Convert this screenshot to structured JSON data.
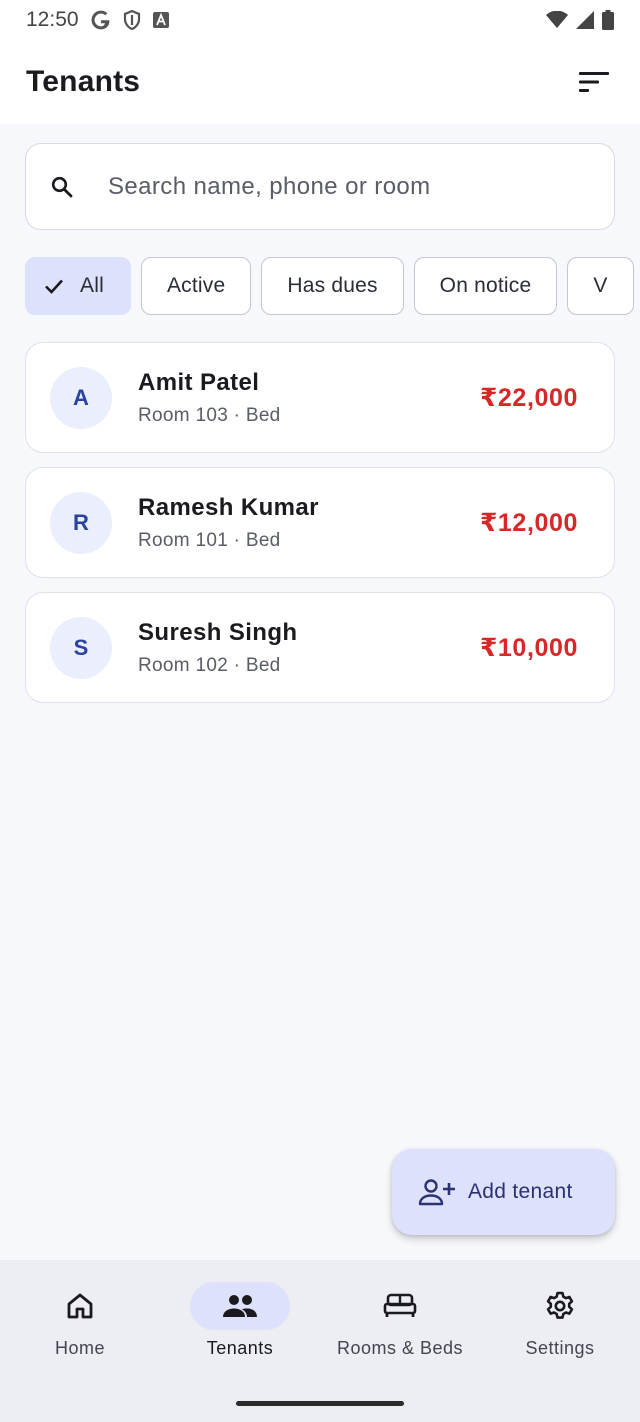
{
  "status_bar": {
    "time": "12:50",
    "icons": [
      "google-icon",
      "shield-icon",
      "font-icon",
      "wifi-icon",
      "signal-icon",
      "battery-icon"
    ]
  },
  "app_bar": {
    "title": "Tenants",
    "sort_icon": "sort-icon"
  },
  "search": {
    "placeholder": "Search name, phone or room",
    "value": ""
  },
  "filters": [
    {
      "label": "All",
      "selected": true
    },
    {
      "label": "Active",
      "selected": false
    },
    {
      "label": "Has dues",
      "selected": false
    },
    {
      "label": "On notice",
      "selected": false
    },
    {
      "label": "V",
      "selected": false
    }
  ],
  "tenants": [
    {
      "initial": "A",
      "name": "Amit Patel",
      "room": "Room 103 · Bed",
      "amount": "₹22,000"
    },
    {
      "initial": "R",
      "name": "Ramesh Kumar",
      "room": "Room 101 · Bed",
      "amount": "₹12,000"
    },
    {
      "initial": "S",
      "name": "Suresh Singh",
      "room": "Room 102 · Bed",
      "amount": "₹10,000"
    }
  ],
  "fab": {
    "label": "Add tenant",
    "icon": "add-person-icon"
  },
  "bottom_nav": [
    {
      "label": "Home",
      "icon": "home-icon",
      "active": false
    },
    {
      "label": "Tenants",
      "icon": "people-icon",
      "active": true
    },
    {
      "label": "Rooms & Beds",
      "icon": "bed-icon",
      "active": false
    },
    {
      "label": "Settings",
      "icon": "gear-icon",
      "active": false
    }
  ],
  "colors": {
    "accent_container": "#dde1fb",
    "due_amount": "#d62828",
    "avatar_bg": "#eaeefd",
    "avatar_text": "#2a43a0"
  }
}
